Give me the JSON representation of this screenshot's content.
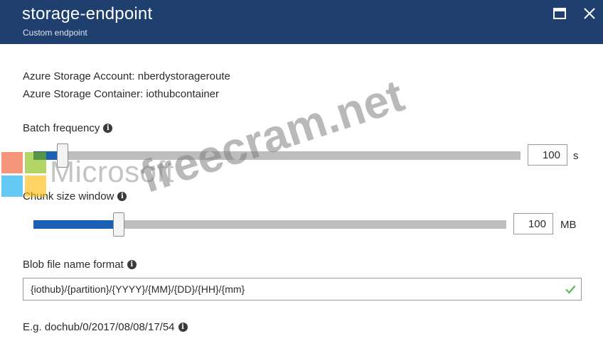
{
  "header": {
    "title": "storage-endpoint",
    "subtitle": "Custom endpoint"
  },
  "account": {
    "storage_account": "Azure Storage Account: nberdystorageroute",
    "storage_container": "Azure Storage Container: iothubcontainer"
  },
  "batch_frequency": {
    "label": "Batch frequency",
    "value": "100",
    "unit": "s",
    "slider_fraction": 0.06
  },
  "chunk_size": {
    "label": "Chunk size window",
    "value": "100",
    "unit": "MB",
    "slider_fraction": 0.18
  },
  "blob_format": {
    "label": "Blob file name format",
    "value": "{iothub}/{partition}/{YYYY}/{MM}/{DD}/{HH}/{mm}"
  },
  "example": {
    "text": "E.g. dochub/0/2017/08/08/17/54"
  },
  "watermark": {
    "brand": "Microsoft",
    "site": "freecram.net"
  },
  "colors": {
    "header_bg": "#1f3f6e",
    "slider_fill": "#1a5fb4",
    "slider_track": "#bdbdbd",
    "check": "#5cb85c"
  }
}
